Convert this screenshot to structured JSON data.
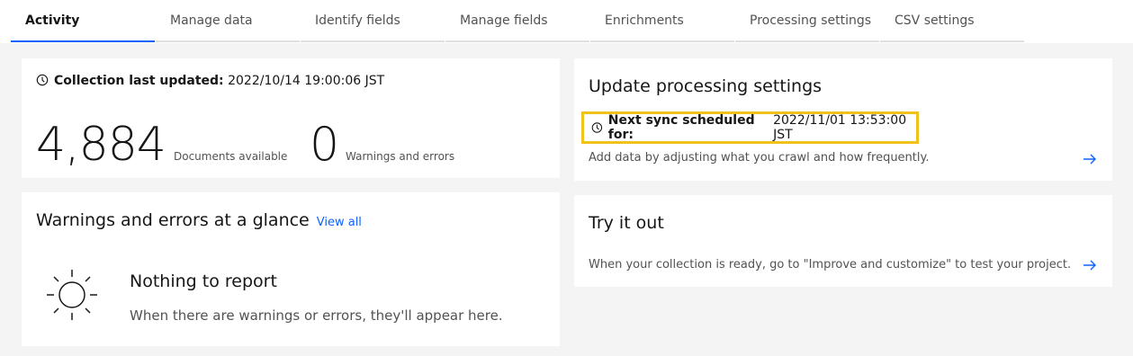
{
  "tabs": [
    {
      "label": "Activity",
      "active": true
    },
    {
      "label": "Manage data",
      "active": false
    },
    {
      "label": "Identify fields",
      "active": false
    },
    {
      "label": "Manage fields",
      "active": false
    },
    {
      "label": "Enrichments",
      "active": false
    },
    {
      "label": "Processing settings",
      "active": false
    },
    {
      "label": "CSV settings",
      "active": false
    }
  ],
  "collection": {
    "updated_label": "Collection last updated:",
    "updated_value": "2022/10/14 19:00:06 JST",
    "documents_count": "4,884",
    "documents_caption": "Documents available",
    "warnings_count": "0",
    "warnings_caption": "Warnings and errors"
  },
  "warnings": {
    "title": "Warnings and errors at a glance",
    "view_all": "View all",
    "empty_title": "Nothing to report",
    "empty_message": "When there are warnings or errors, they'll appear here."
  },
  "processing": {
    "title": "Update processing settings",
    "sync_label": "Next sync scheduled for:",
    "sync_value": "2022/11/01 13:53:00 JST",
    "description": "Add data by adjusting what you crawl and how frequently."
  },
  "try_it": {
    "title": "Try it out",
    "description": "When your collection is ready, go to \"Improve and customize\" to test your project."
  },
  "colors": {
    "accent": "#0f62fe",
    "highlight": "#f1c21b",
    "background": "#f4f4f4"
  }
}
